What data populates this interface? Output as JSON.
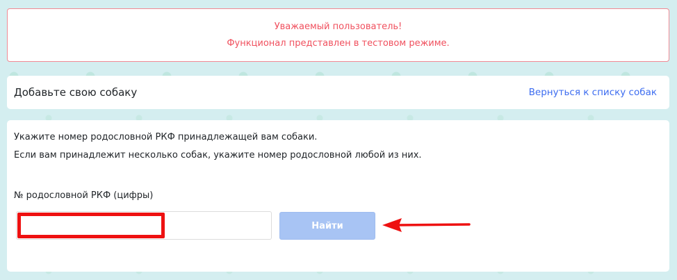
{
  "alert": {
    "line1": "Уважаемый пользователь!",
    "line2": "Функционал представлен в тестовом режиме."
  },
  "header": {
    "title": "Добавьте свою собаку",
    "back_link": "Вернуться к списку собак"
  },
  "form": {
    "instruction_1": "Укажите номер родословной РКФ принадлежащей вам собаки.",
    "instruction_2": "Если вам принадлежит несколько собак, укажите номер родословной любой из них.",
    "field_label": "№ родословной РКФ (цифры)",
    "pedigree_value": "",
    "submit_label": "Найти"
  },
  "colors": {
    "alert_text": "#f0505e",
    "alert_border": "#f08a94",
    "link": "#3c6cf0",
    "button_disabled": "#a8c4f4",
    "annotation_red": "#ee1111"
  }
}
